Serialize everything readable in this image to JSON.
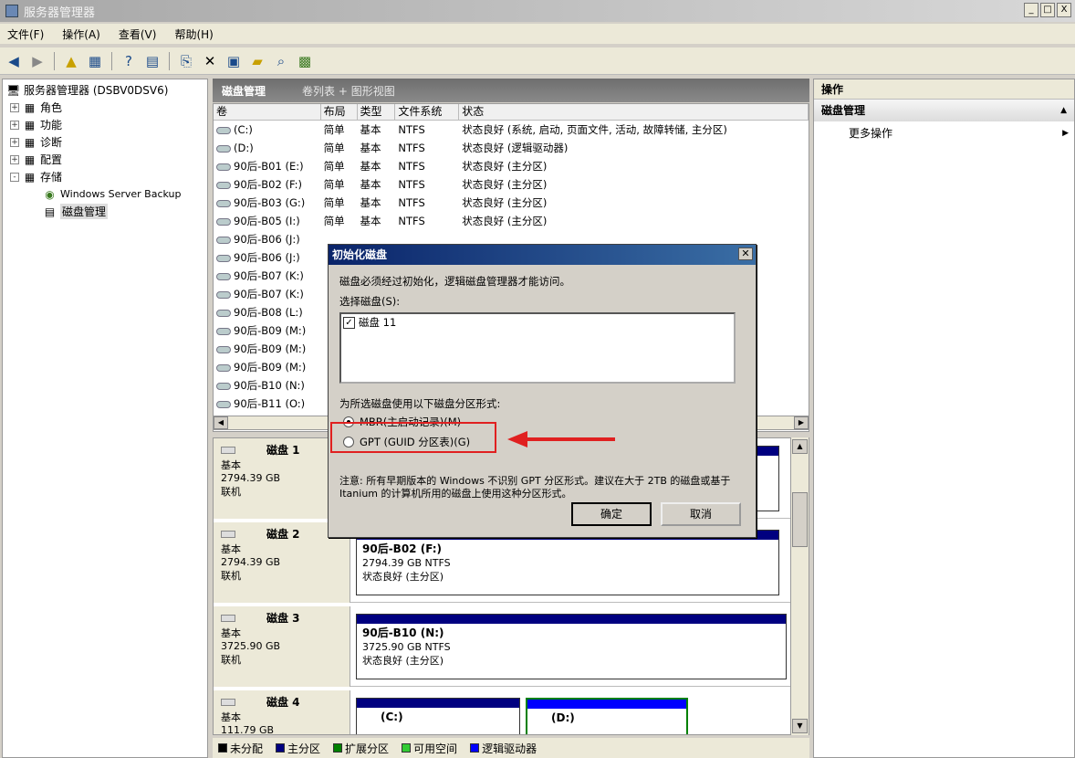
{
  "window": {
    "title": "服务器管理器",
    "controls": [
      "_",
      "□",
      "X"
    ]
  },
  "menu": [
    "文件(F)",
    "操作(A)",
    "查看(V)",
    "帮助(H)"
  ],
  "toolbar_icons": [
    "back-icon",
    "forward-icon",
    "up-folder-icon",
    "show-hide-tree-icon",
    "help-icon",
    "view-icon",
    "refresh-icon",
    "delete-icon",
    "properties-icon",
    "open-icon",
    "search-icon",
    "settings-icon"
  ],
  "tree": [
    {
      "label": "服务器管理器 (DSBV0DSV6)",
      "level": 0,
      "icon": "server-icon"
    },
    {
      "label": "角色",
      "level": 1,
      "icon": "roles-icon",
      "exp": "+"
    },
    {
      "label": "功能",
      "level": 1,
      "icon": "features-icon",
      "exp": "+"
    },
    {
      "label": "诊断",
      "level": 1,
      "icon": "diagnostics-icon",
      "exp": "+"
    },
    {
      "label": "配置",
      "level": 1,
      "icon": "config-icon",
      "exp": "+"
    },
    {
      "label": "存储",
      "level": 1,
      "icon": "storage-icon",
      "exp": "-"
    },
    {
      "label": "Windows Server Backup",
      "level": 2,
      "icon": "backup-icon"
    },
    {
      "label": "磁盘管理",
      "level": 2,
      "icon": "disk-mgmt-icon",
      "selected": true
    }
  ],
  "center": {
    "title": "磁盘管理",
    "view": "卷列表 + 图形视图"
  },
  "volume_columns": [
    "卷",
    "布局",
    "类型",
    "文件系统",
    "状态"
  ],
  "volumes": [
    [
      "(C:)",
      "简单",
      "基本",
      "NTFS",
      "状态良好 (系统, 启动, 页面文件, 活动, 故障转储, 主分区)"
    ],
    [
      "(D:)",
      "简单",
      "基本",
      "NTFS",
      "状态良好 (逻辑驱动器)"
    ],
    [
      "90后-B01 (E:)",
      "简单",
      "基本",
      "NTFS",
      "状态良好 (主分区)"
    ],
    [
      "90后-B02 (F:)",
      "简单",
      "基本",
      "NTFS",
      "状态良好 (主分区)"
    ],
    [
      "90后-B03 (G:)",
      "简单",
      "基本",
      "NTFS",
      "状态良好 (主分区)"
    ],
    [
      "90后-B05 (I:)",
      "简单",
      "基本",
      "NTFS",
      "状态良好 (主分区)"
    ],
    [
      "90后-B06 (J:)",
      "",
      "",
      "",
      ""
    ],
    [
      "90后-B06 (J:)",
      "",
      "",
      "",
      ""
    ],
    [
      "90后-B07 (K:)",
      "",
      "",
      "",
      ""
    ],
    [
      "90后-B07 (K:)",
      "",
      "",
      "",
      ""
    ],
    [
      "90后-B08 (L:)",
      "",
      "",
      "",
      ""
    ],
    [
      "90后-B09 (M:)",
      "",
      "",
      "",
      ""
    ],
    [
      "90后-B09 (M:)",
      "",
      "",
      "",
      ""
    ],
    [
      "90后-B09 (M:)",
      "",
      "",
      "",
      ""
    ],
    [
      "90后-B10 (N:)",
      "",
      "",
      "",
      ""
    ],
    [
      "90后-B11 (O:)",
      "",
      "",
      "",
      ""
    ]
  ],
  "disks": [
    {
      "name": "磁盘 1",
      "type": "基本",
      "size": "2794.39 GB",
      "status": "联机",
      "partitions": []
    },
    {
      "name": "磁盘 2",
      "type": "基本",
      "size": "2794.39 GB",
      "status": "联机",
      "partitions": [
        {
          "label": "90后-B02 (F:)",
          "size": "2794.39 GB NTFS",
          "status": "状态良好 (主分区)"
        }
      ]
    },
    {
      "name": "磁盘 3",
      "type": "基本",
      "size": "3725.90 GB",
      "status": "联机",
      "partitions": [
        {
          "label": "90后-B10 (N:)",
          "size": "3725.90 GB NTFS",
          "status": "状态良好 (主分区)"
        }
      ]
    },
    {
      "name": "磁盘 4",
      "type": "基本",
      "size": "111.79 GB",
      "status": "",
      "partitions": [
        {
          "label": "(C:)",
          "size": "",
          "status": ""
        },
        {
          "label": "(D:)",
          "size": "",
          "status": ""
        }
      ]
    }
  ],
  "legend": [
    {
      "label": "未分配",
      "color": "#000000"
    },
    {
      "label": "主分区",
      "color": "#000080"
    },
    {
      "label": "扩展分区",
      "color": "#008000"
    },
    {
      "label": "可用空间",
      "color": "#33cc33"
    },
    {
      "label": "逻辑驱动器",
      "color": "#0000ff"
    }
  ],
  "actions": {
    "header": "操作",
    "section": "磁盘管理",
    "item": "更多操作"
  },
  "dialog": {
    "title": "初始化磁盘",
    "intro": "磁盘必须经过初始化，逻辑磁盘管理器才能访问。",
    "select_label": "选择磁盘(S):",
    "disk_item": "磁盘 11",
    "partition_label": "为所选磁盘使用以下磁盘分区形式:",
    "mbr": "MBR(主启动记录)(M)",
    "gpt": "GPT (GUID 分区表)(G)",
    "note": "注意: 所有早期版本的 Windows 不识别 GPT 分区形式。建议在大于 2TB 的磁盘或基于 Itanium 的计算机所用的磁盘上使用这种分区形式。",
    "ok": "确定",
    "cancel": "取消"
  },
  "colors": {
    "highlight": "#e02020",
    "title_blue": "#0a246a",
    "primary_partition": "#000080"
  }
}
